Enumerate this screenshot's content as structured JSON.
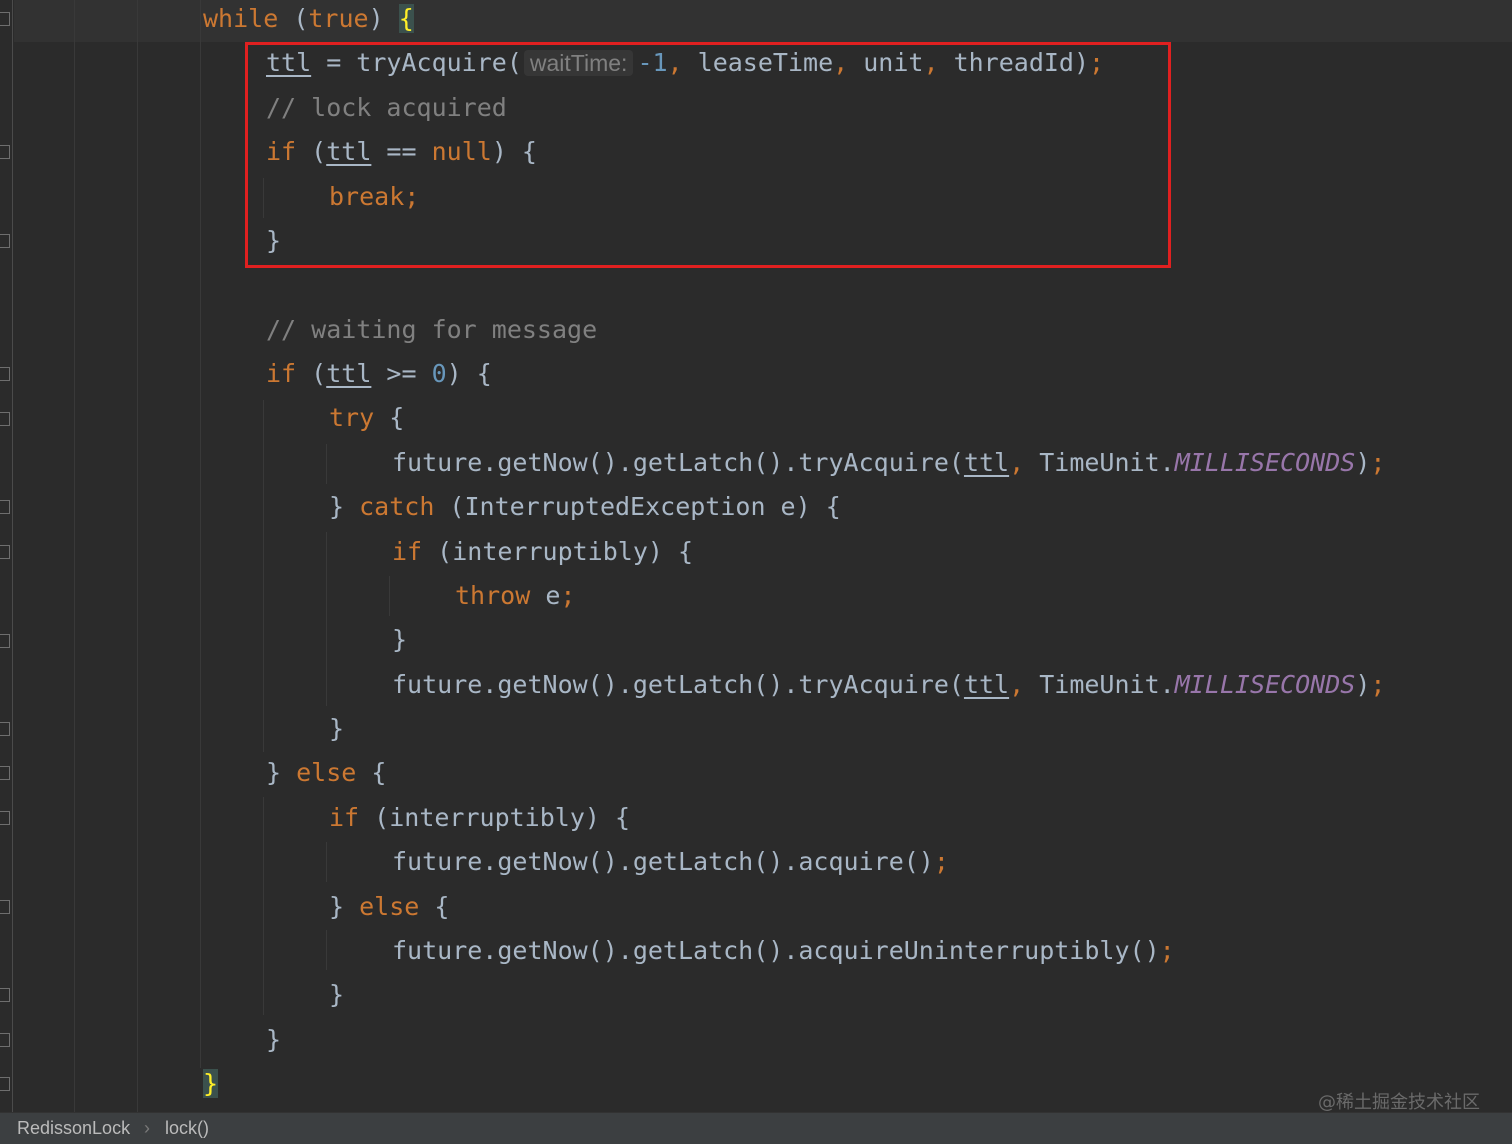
{
  "code": {
    "l1": {
      "a": "while",
      "b": " (",
      "c": "true",
      "d": ") ",
      "e": "{"
    },
    "l2": {
      "a": "ttl",
      "b": " = tryAcquire(",
      "hint": "waitTime:",
      "c": "-1",
      "d": ", ",
      "e": "leaseTime",
      "f": ", ",
      "g": "unit",
      "h": ", ",
      "i": "threadId)",
      "j": ";"
    },
    "l3": {
      "a": "// lock acquired"
    },
    "l4": {
      "a": "if",
      "b": " (",
      "c": "ttl",
      "d": " == ",
      "e": "null",
      "f": ") {"
    },
    "l5": {
      "a": "break;"
    },
    "l6": {
      "a": "}"
    },
    "l8": {
      "a": "// waiting for message"
    },
    "l9": {
      "a": "if",
      "b": " (",
      "c": "ttl",
      "d": " >= ",
      "e": "0",
      "f": ") {"
    },
    "l10": {
      "a": "try",
      "b": " {"
    },
    "l11": {
      "a": "future.getNow().getLatch().tryAcquire(",
      "b": "ttl",
      "c": ",",
      "d": " TimeUnit.",
      "e": "MILLISECONDS",
      "f": ")",
      "g": ";"
    },
    "l12": {
      "a": "} ",
      "b": "catch",
      "c": " (InterruptedException e) {"
    },
    "l13": {
      "a": "if",
      "b": " (interruptibly) {"
    },
    "l14": {
      "a": "throw",
      "b": " e",
      "c": ";"
    },
    "l15": {
      "a": "}"
    },
    "l16": {
      "a": "future.getNow().getLatch().tryAcquire(",
      "b": "ttl",
      "c": ",",
      "d": " TimeUnit.",
      "e": "MILLISECONDS",
      "f": ")",
      "g": ";"
    },
    "l17": {
      "a": "}"
    },
    "l18": {
      "a": "} ",
      "b": "else",
      "c": " {"
    },
    "l19": {
      "a": "if",
      "b": " (interruptibly) {"
    },
    "l20": {
      "a": "future.getNow().getLatch().acquire()",
      "b": ";"
    },
    "l21": {
      "a": "} ",
      "b": "else",
      "c": " {"
    },
    "l22": {
      "a": "future.getNow().getLatch().acquireUninterruptibly()",
      "b": ";"
    },
    "l23": {
      "a": "}"
    },
    "l24": {
      "a": "}"
    },
    "l25": {
      "a": "}"
    }
  },
  "statusbar": {
    "class_name": "RedissonLock",
    "separator": "›",
    "method_name": "lock()"
  },
  "watermark": "@稀土掘金技术社区",
  "colors": {
    "background": "#2b2b2b",
    "keyword": "#cc7832",
    "number": "#6897bb",
    "comment": "#808080",
    "constant": "#9876aa",
    "highlight_box": "#e02020",
    "matched_brace": "#ffef28"
  },
  "icons": {
    "fold_markers": "fold-marker-icon",
    "breadcrumb_separator": "chevron-right-icon"
  }
}
